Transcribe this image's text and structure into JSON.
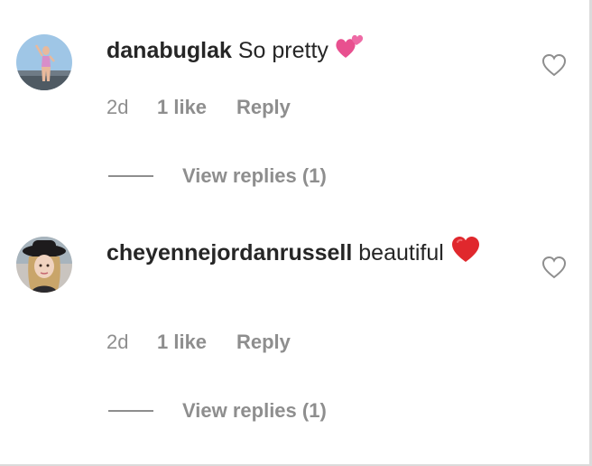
{
  "comments": [
    {
      "username": "danabuglak",
      "text": "So pretty",
      "emoji": "two-hearts",
      "time": "2d",
      "likes": "1 like",
      "reply_label": "Reply",
      "view_replies": "View replies (1)"
    },
    {
      "username": "cheyennejordanrussell",
      "text": "beautiful",
      "emoji": "red-heart",
      "time": "2d",
      "likes": "1 like",
      "reply_label": "Reply",
      "view_replies": "View replies (1)"
    }
  ],
  "icons": {
    "like": "heart-outline-icon"
  },
  "colors": {
    "text": "#262626",
    "secondary": "#8e8e8e",
    "heart_pink": "#e8508f",
    "heart_red": "#e0282d"
  }
}
